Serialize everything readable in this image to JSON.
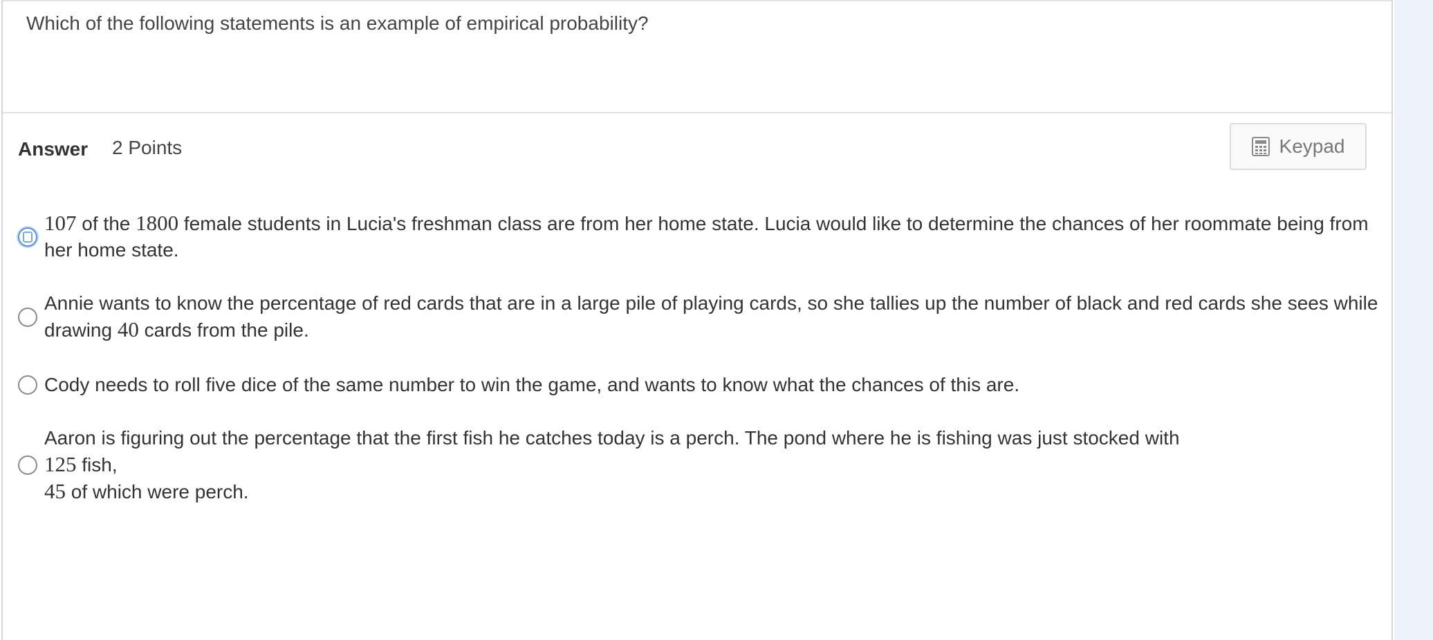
{
  "question": {
    "text": "Which of the following statements is an example of empirical probability?"
  },
  "answer": {
    "label": "Answer",
    "points": "2 Points"
  },
  "keypad": {
    "label": "Keypad",
    "icon": "calculator-icon"
  },
  "options": [
    {
      "num1": "107",
      "part1": " of the ",
      "num2": "1800",
      "part2": " female students in Lucia's freshman class are from her home state. Lucia would like to determine the chances of her roommate being from her home state."
    },
    {
      "part1": "Annie wants to know the percentage of red cards that are in a large pile of playing cards, so she tallies up the number of black and red cards she sees while drawing ",
      "num1": "40",
      "part2": " cards from the pile."
    },
    {
      "text": "Cody needs to roll five dice of the same number to win the game, and wants to know what the chances of this are."
    },
    {
      "line1": "Aaron is figuring out the percentage that the first fish he catches today is a perch. The pond where he is fishing was just stocked with",
      "num1": "125",
      "line2_rest": " fish,",
      "num2": "45",
      "line3_rest": " of which were perch."
    }
  ]
}
